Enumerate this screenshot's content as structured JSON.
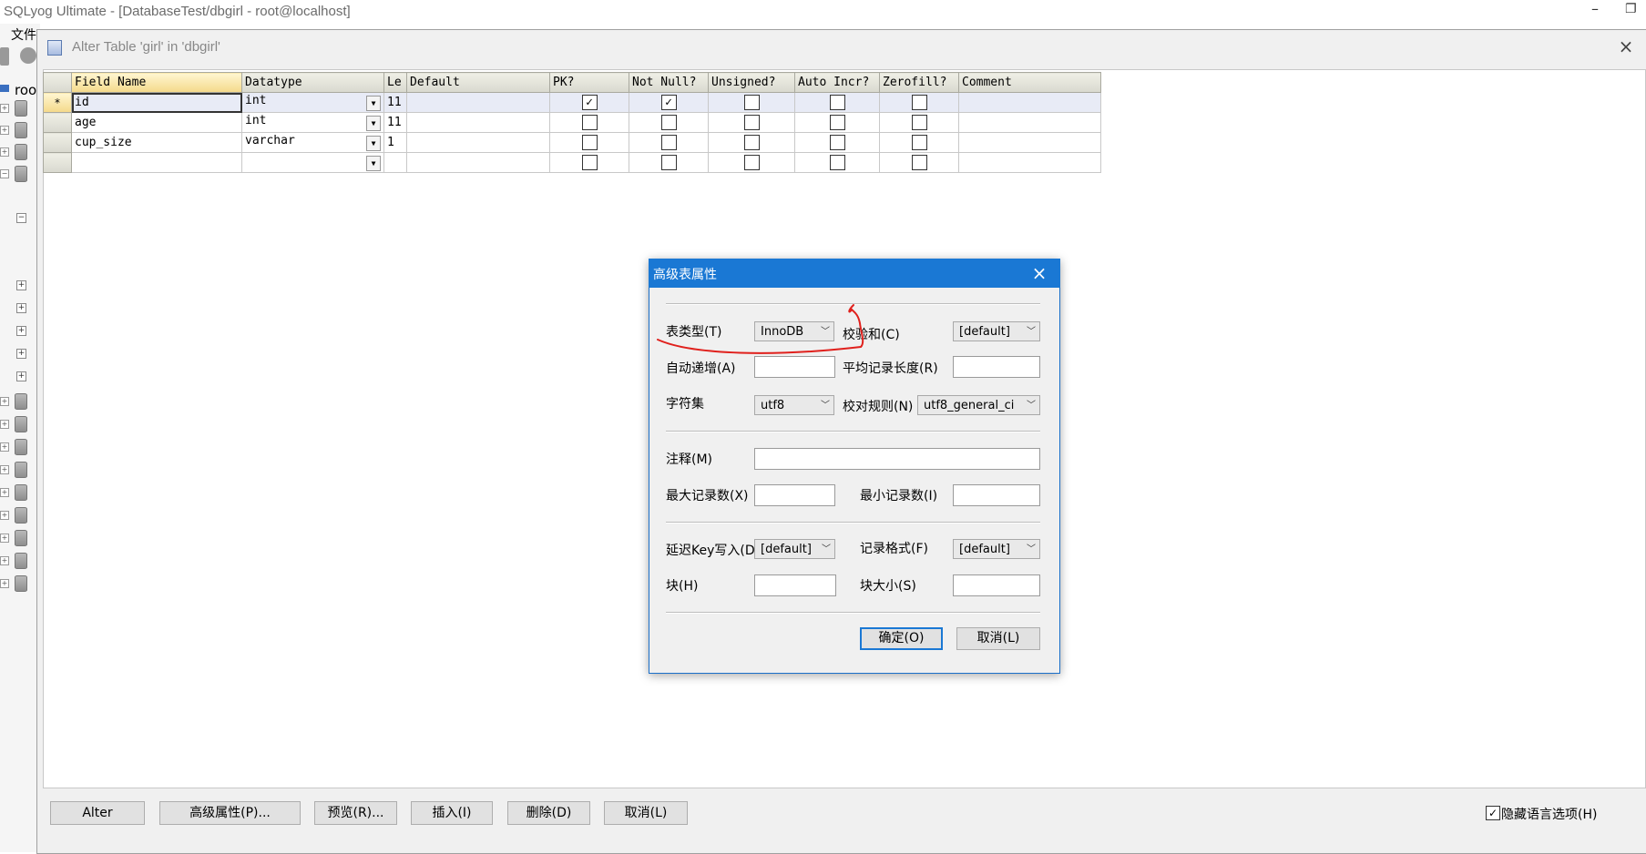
{
  "app": {
    "title": "SQLyog Ultimate - [DatabaseTest/dbgirl - root@localhost]",
    "menu_fragment": "文件",
    "tree_root_fragment": "roo"
  },
  "window": {
    "title": "Alter Table 'girl' in 'dbgirl'",
    "close_icon": "×"
  },
  "grid": {
    "columns": [
      "Field Name",
      "Datatype",
      "Le",
      "Default",
      "PK?",
      "Not Null?",
      "Unsigned?",
      "Auto Incr?",
      "Zerofill?",
      "Comment"
    ],
    "rows": [
      {
        "marker": "*",
        "field": "id",
        "datatype": "int",
        "len": "11",
        "default": "",
        "pk": true,
        "notnull": true,
        "unsigned": false,
        "autoincr": false,
        "zerofill": false,
        "comment": ""
      },
      {
        "marker": "",
        "field": "age",
        "datatype": "int",
        "len": "11",
        "default": "",
        "pk": false,
        "notnull": false,
        "unsigned": false,
        "autoincr": false,
        "zerofill": false,
        "comment": ""
      },
      {
        "marker": "",
        "field": "cup_size",
        "datatype": "varchar",
        "len": "1",
        "default": "",
        "pk": false,
        "notnull": false,
        "unsigned": false,
        "autoincr": false,
        "zerofill": false,
        "comment": ""
      },
      {
        "marker": "",
        "field": "",
        "datatype": "",
        "len": "",
        "default": "",
        "pk": false,
        "notnull": false,
        "unsigned": false,
        "autoincr": false,
        "zerofill": false,
        "comment": ""
      }
    ]
  },
  "dialog": {
    "title": "高级表属性",
    "labels": {
      "table_type": "表类型(T)",
      "checksum": "校验和(C)",
      "auto_incr": "自动递增(A)",
      "avg_row_len": "平均记录长度(R)",
      "charset": "字符集",
      "collation": "校对规则(N)",
      "comment": "注释(M)",
      "max_rows": "最大记录数(X)",
      "min_rows": "最小记录数(I)",
      "delay_key": "延迟Key写入(D",
      "row_format": "记录格式(F)",
      "block": "块(H)",
      "block_size": "块大小(S)"
    },
    "values": {
      "table_type": "InnoDB",
      "checksum": "[default]",
      "charset": "utf8",
      "collation": "utf8_general_ci",
      "delay_key": "[default]",
      "row_format": "[default]"
    },
    "buttons": {
      "ok": "确定(O)",
      "cancel": "取消(L)"
    }
  },
  "toolbar": {
    "buttons": [
      "Alter",
      "高级属性(P)...",
      "预览(R)...",
      "插入(I)",
      "删除(D)",
      "取消(L)"
    ],
    "hide_lang_label": "隐藏语言选项(H)",
    "hide_lang_checked": true
  },
  "annotation_color": "#e0201c"
}
